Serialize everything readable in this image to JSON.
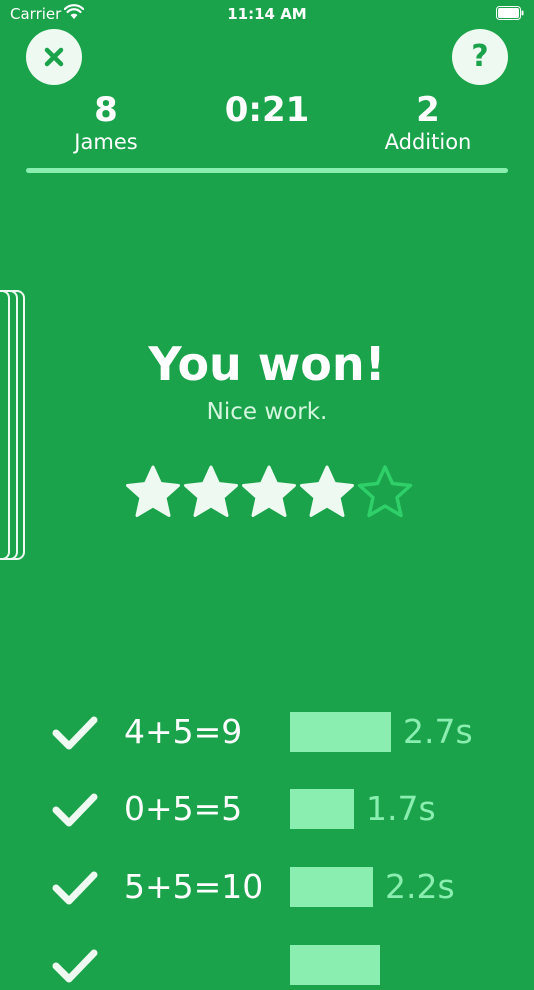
{
  "status": {
    "carrier": "Carrier",
    "time": "11:14 AM"
  },
  "header": {
    "close_icon": "close-icon",
    "help_icon": "question-icon",
    "help_glyph": "?",
    "player_score": "8",
    "player_name": "James",
    "timer": "0:21",
    "level": "2",
    "mode": "Addition",
    "progress_fraction": 1.0
  },
  "result": {
    "title": "You won!",
    "subtitle": "Nice work.",
    "stars_filled": 4,
    "stars_total": 5
  },
  "problems": [
    {
      "equation": "4+5=9",
      "time": "2.7s",
      "seconds": 2.7,
      "correct": true
    },
    {
      "equation": "0+5=5",
      "time": "1.7s",
      "seconds": 1.7,
      "correct": true
    },
    {
      "equation": "5+5=10",
      "time": "2.2s",
      "seconds": 2.2,
      "correct": true
    },
    {
      "equation": "",
      "time": "",
      "seconds": 2.4,
      "correct": true
    }
  ],
  "colors": {
    "background": "#1aa34a",
    "light": "#eefaf1",
    "accent": "#8aeeb0",
    "star_empty": "#2fcf6a"
  }
}
